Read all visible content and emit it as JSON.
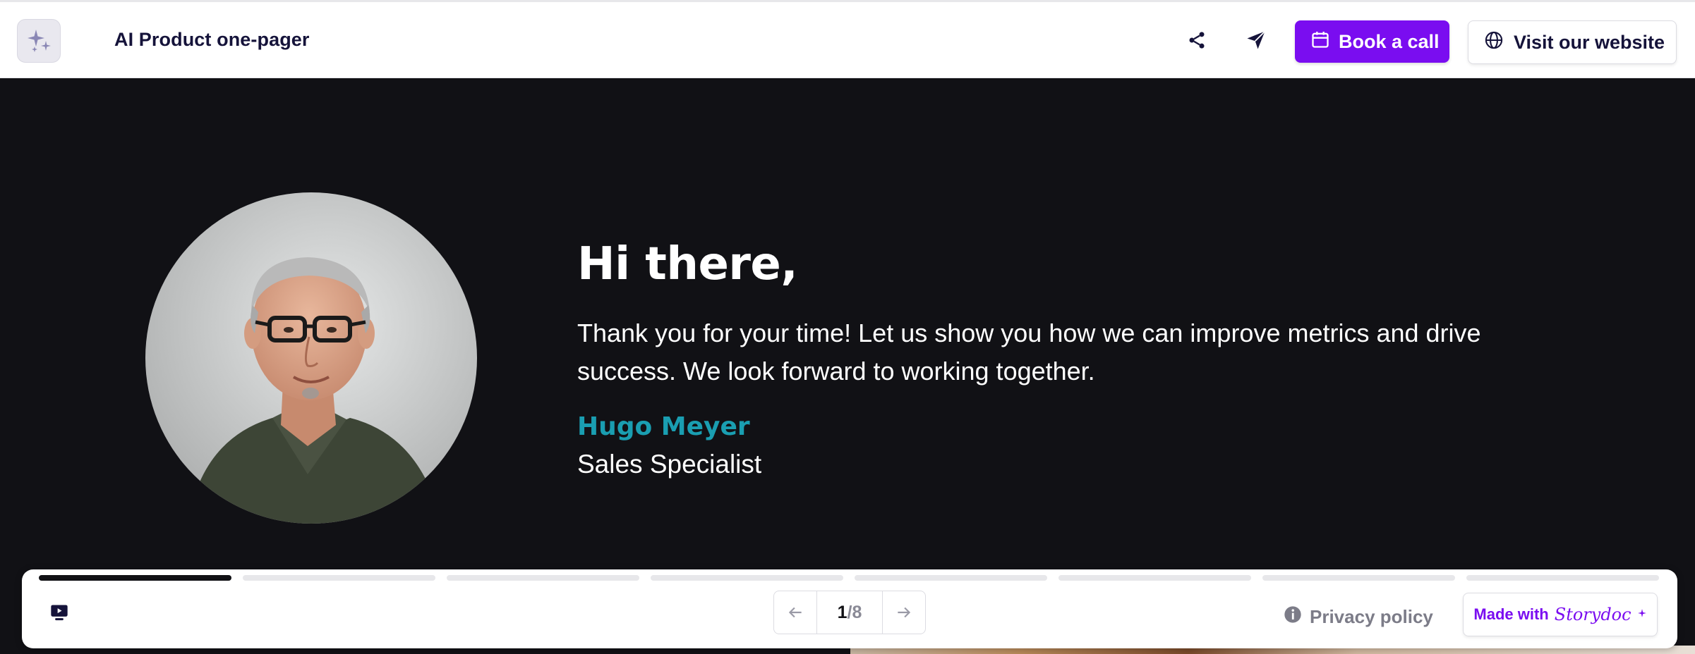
{
  "header": {
    "doc_title": "AI Product one-pager",
    "book_label": "Book a call",
    "visit_label": "Visit our website",
    "icons": [
      "sparkles-icon",
      "share-icon",
      "send-icon",
      "calendar-icon",
      "globe-icon"
    ]
  },
  "hero": {
    "greeting": "Hi there,",
    "message": "Thank you for your time! Let us show you how we can improve metrics and drive success. We look forward to working together.",
    "sender_name": "Hugo Meyer",
    "sender_role": "Sales Specialist"
  },
  "footer": {
    "progress": {
      "total_segments": 8,
      "current_segment": 1
    },
    "pager": {
      "current": "1",
      "separator": "/",
      "total": "8"
    },
    "privacy_label": "Privacy policy",
    "made_with_label": "Made with",
    "made_with_brand": "Storydoc"
  },
  "colors": {
    "accent": "#7a0df0",
    "background": "#111115",
    "name_color": "#1a9eb1",
    "text_dark": "#15133a"
  }
}
